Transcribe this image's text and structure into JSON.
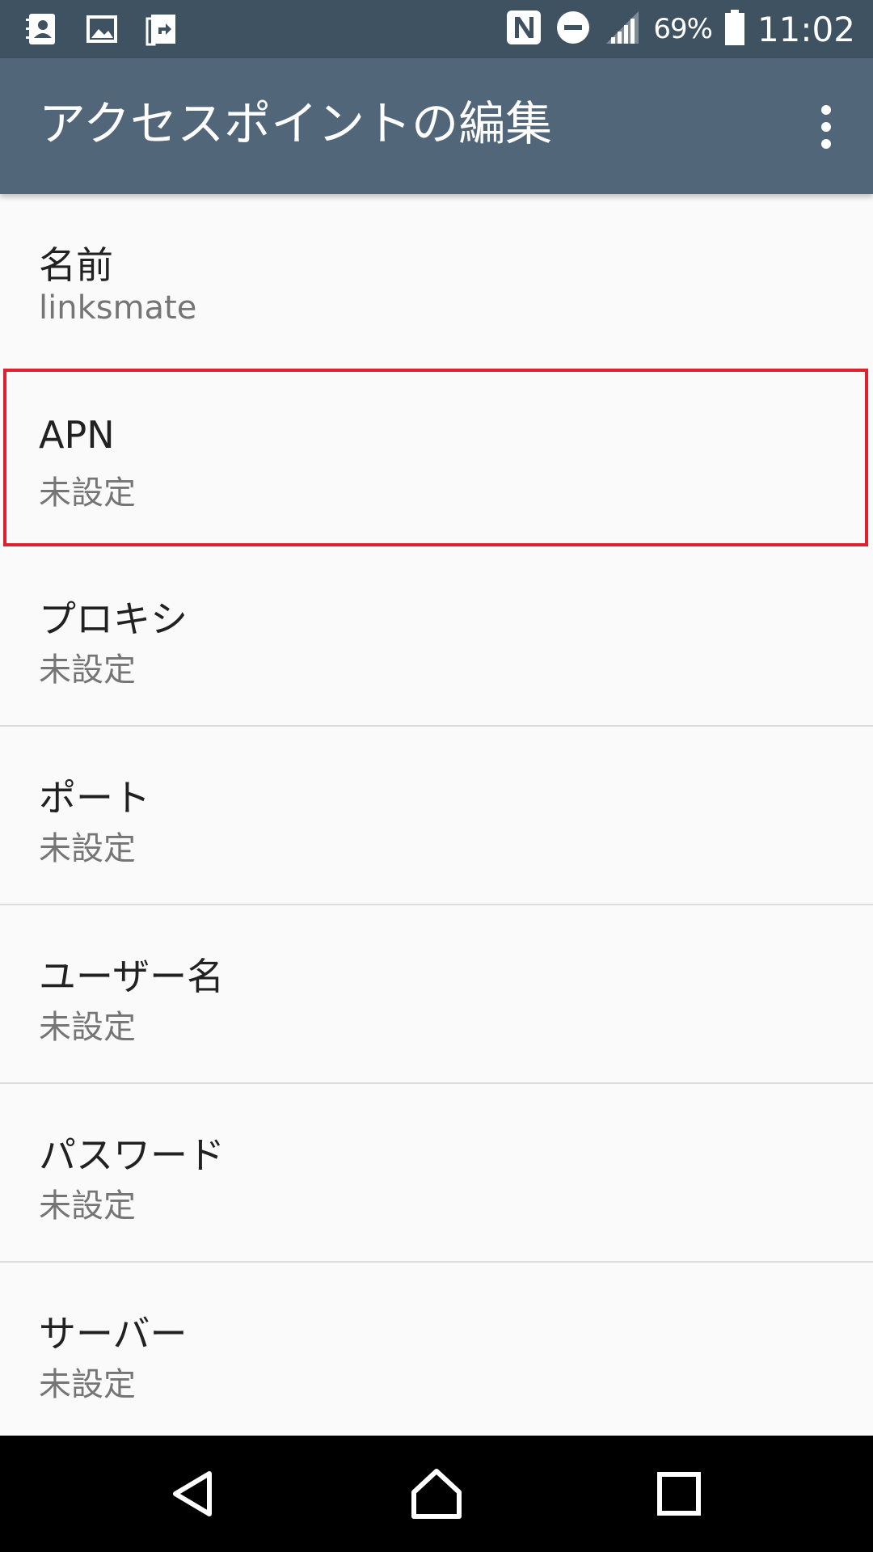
{
  "status_bar": {
    "battery_percent": "69%",
    "time": "11:02",
    "left_icons": [
      "contacts-icon",
      "gallery-icon",
      "transfer-icon"
    ],
    "right_icons": [
      "nfc-icon",
      "do-not-disturb-icon",
      "signal-icon",
      "battery-icon"
    ]
  },
  "app_bar": {
    "title": "アクセスポイントの編集",
    "menu_icon": "more-vert-icon"
  },
  "preferences": [
    {
      "title": "名前",
      "summary": "linksmate"
    },
    {
      "title": "APN",
      "summary": "未設定"
    },
    {
      "title": "プロキシ",
      "summary": "未設定"
    },
    {
      "title": "ポート",
      "summary": "未設定"
    },
    {
      "title": "ユーザー名",
      "summary": "未設定"
    },
    {
      "title": "パスワード",
      "summary": "未設定"
    },
    {
      "title": "サーバー",
      "summary": "未設定"
    }
  ],
  "highlight": {
    "target": "APN",
    "color": "#e02030"
  },
  "nav_bar": {
    "buttons": [
      "back-icon",
      "home-icon",
      "recents-icon"
    ]
  },
  "colors": {
    "status_bar": "#3f5262",
    "app_bar": "#526679",
    "background": "#fafafa"
  }
}
